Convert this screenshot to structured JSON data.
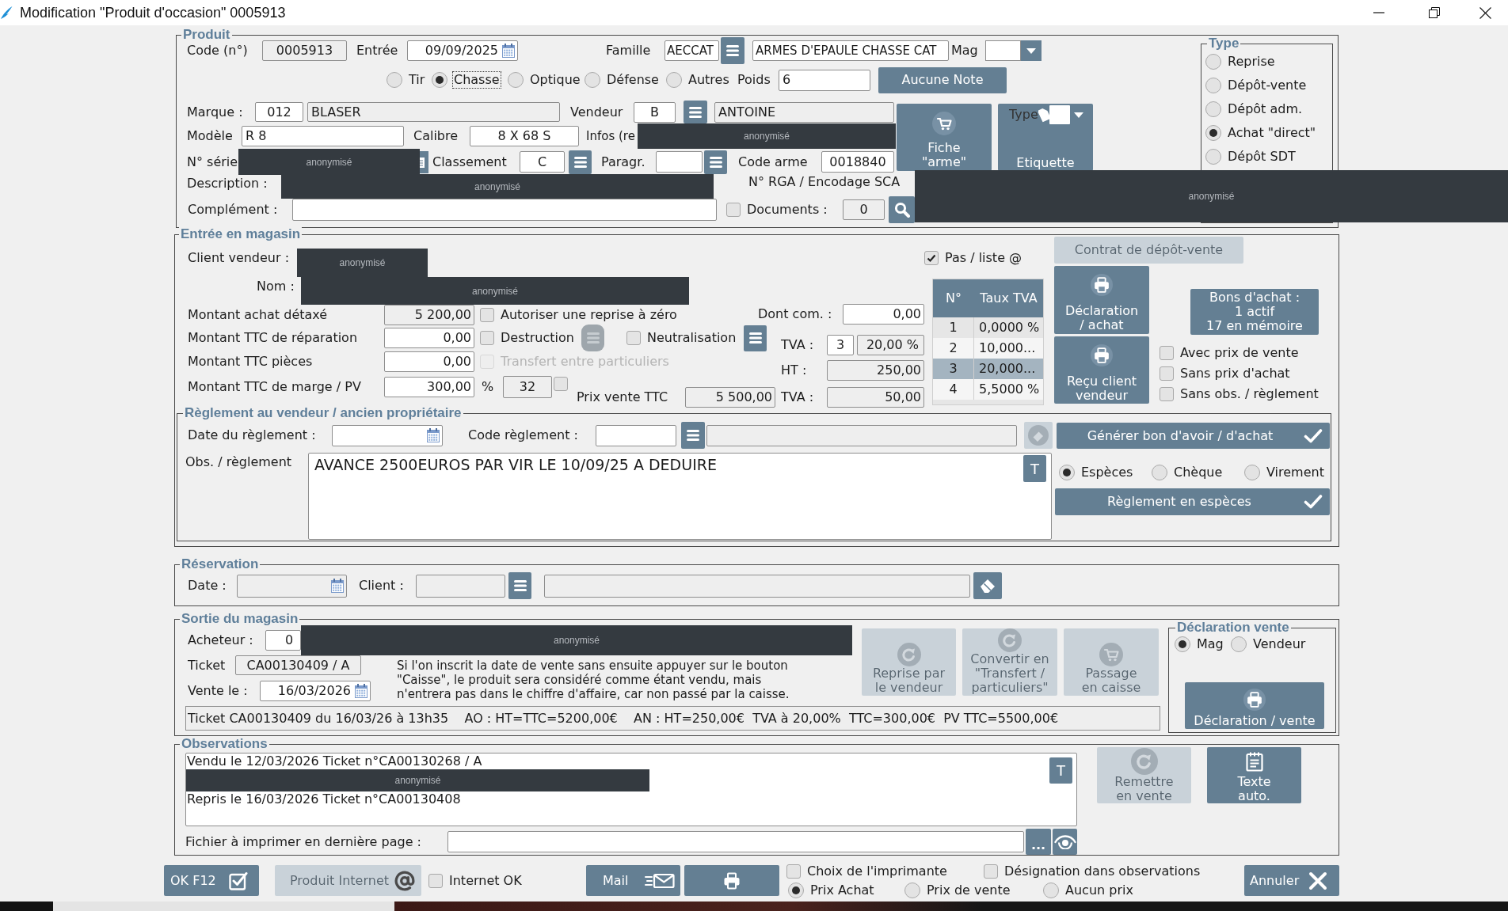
{
  "window": {
    "title": "Modification \"Produit d'occasion\" 0005913"
  },
  "produit": {
    "legend": "Produit",
    "code": {
      "label": "Code (n°)",
      "value": "0005913"
    },
    "entree": {
      "label": "Entrée",
      "value": "09/09/2025"
    },
    "famille": {
      "label": "Famille",
      "code": "AECCAT",
      "value": "ARMES D'EPAULE CHASSE CAT"
    },
    "mag": {
      "label": "Mag"
    },
    "categories": [
      {
        "label": "Tir",
        "selected": false,
        "focused": false
      },
      {
        "label": "Chasse",
        "selected": true,
        "focused": true
      },
      {
        "label": "Optique",
        "selected": false,
        "focused": false
      },
      {
        "label": "Défense",
        "selected": false,
        "focused": false
      },
      {
        "label": "Autres",
        "selected": false,
        "focused": false
      }
    ],
    "poids": {
      "label": "Poids",
      "value": "6"
    },
    "note_button": "Aucune Note",
    "marque": {
      "label": "Marque :",
      "code": "012",
      "value": "BLASER"
    },
    "vendeur": {
      "label": "Vendeur",
      "code": "B",
      "value": "ANTOINE"
    },
    "modele": {
      "label": "Modèle",
      "value": "R 8"
    },
    "calibre": {
      "label": "Calibre",
      "value": "8 X 68 S"
    },
    "infos": {
      "label": "Infos (re",
      "redaction": "anonymisé"
    },
    "serie": {
      "label": "N° série",
      "redaction": "anonymisé"
    },
    "classement": {
      "label": "Classement",
      "value": "C"
    },
    "paragraphe": {
      "label": "Paragr."
    },
    "code_arme": {
      "label": "Code arme",
      "value": "0018840"
    },
    "description": {
      "label": "Description :",
      "redaction": "anonymisé"
    },
    "rga": {
      "label": "N° RGA / Encodage SCA",
      "redaction": "anonymisé"
    },
    "complement": {
      "label": "Complément :"
    },
    "documents": {
      "label": "Documents :",
      "checked": false,
      "count": "0"
    },
    "fiche_button": "Fiche\n\"arme\"",
    "etiquette_button": {
      "label": "Etiquette",
      "type_label": "Type"
    },
    "type": {
      "legend": "Type",
      "options": [
        {
          "label": "Reprise",
          "selected": false
        },
        {
          "label": "Dépôt-vente",
          "selected": false
        },
        {
          "label": "Dépôt adm.",
          "selected": false
        },
        {
          "label": "Achat \"direct\"",
          "selected": true
        },
        {
          "label": "Dépôt SDT",
          "selected": false
        }
      ]
    }
  },
  "entree_magasin": {
    "legend": "Entrée en magasin",
    "client_vendeur": {
      "label": "Client vendeur :",
      "redaction": "anonymisé"
    },
    "nom": {
      "label": "Nom :",
      "redaction": "anonymisé"
    },
    "achat": {
      "label": "Montant achat détaxé",
      "value": "5 200,00"
    },
    "autoriser_zero": {
      "label": "Autoriser une reprise à zéro",
      "checked": false
    },
    "reparation": {
      "label": "Montant TTC de réparation",
      "value": "0,00"
    },
    "destruction": {
      "label": "Destruction",
      "checked": false
    },
    "destruction_list": {
      "disabled": true
    },
    "neutralisation": {
      "label": "Neutralisation",
      "checked": false
    },
    "pieces": {
      "label": "Montant TTC pièces",
      "value": "0,00"
    },
    "transfert": {
      "label": "Transfert entre particuliers",
      "checked": false,
      "disabled": true
    },
    "marge": {
      "label": "Montant TTC de marge / PV",
      "value": "300,00",
      "percent_label": "%",
      "percent": "32",
      "checked": false
    },
    "prix_vente": {
      "label": "Prix vente TTC",
      "value": "5 500,00"
    },
    "dont_com": {
      "label": "Dont com. :",
      "value": "0,00"
    },
    "tva": {
      "label": "TVA :",
      "code": "3",
      "rate": "20,00 %"
    },
    "ht": {
      "label": "HT :",
      "value": "250,00"
    },
    "tva_amount": {
      "label": "TVA :",
      "value": "50,00"
    },
    "pas_liste": {
      "label": "Pas / liste @",
      "checked": true
    },
    "tva_table": {
      "columns": [
        "N°",
        "Taux TVA"
      ],
      "rows": [
        {
          "cells": [
            "1",
            "0,0000 %"
          ],
          "selected": false
        },
        {
          "cells": [
            "2",
            "10,000..."
          ],
          "selected": false
        },
        {
          "cells": [
            "3",
            "20,000..."
          ],
          "selected": true
        },
        {
          "cells": [
            "4",
            "5,5000 %"
          ],
          "selected": false
        }
      ]
    },
    "contrat_button": {
      "label": "Contrat de dépôt-vente",
      "disabled": true
    },
    "declaration_achat_button": "Déclaration\n/ achat",
    "recu_button": "Reçu client\nvendeur",
    "bons_button": "Bons d'achat :\n1 actif\n17 en mémoire",
    "print_options": [
      {
        "label": "Avec prix de vente",
        "checked": false
      },
      {
        "label": "Sans prix d'achat",
        "checked": false
      },
      {
        "label": "Sans obs. / règlement",
        "checked": false
      }
    ]
  },
  "reglement": {
    "legend": "Règlement au vendeur / ancien propriétaire",
    "date": {
      "label": "Date du règlement :"
    },
    "code": {
      "label": "Code règlement :"
    },
    "eraser_button": {
      "disabled": true
    },
    "generer_button": "Générer bon d'avoir / d'achat",
    "obs": {
      "label": "Obs. / règlement",
      "value": "AVANCE 2500EUROS PAR VIR LE 10/09/25 A DEDUIRE",
      "t_button": "T"
    },
    "modes": [
      {
        "label": "Espèces",
        "selected": true
      },
      {
        "label": "Chèque",
        "selected": false
      },
      {
        "label": "Virement",
        "selected": false
      }
    ],
    "reglement_button": "Règlement en espèces"
  },
  "reservation": {
    "legend": "Réservation",
    "date": {
      "label": "Date :"
    },
    "client": {
      "label": "Client :"
    }
  },
  "sortie": {
    "legend": "Sortie du magasin",
    "acheteur": {
      "label": "Acheteur :",
      "value": "0",
      "redaction": "anonymisé"
    },
    "ticket": {
      "label": "Ticket",
      "value": "CA00130409 / A"
    },
    "vente": {
      "label": "Vente le :",
      "value": "16/03/2026"
    },
    "notice": "Si l'on inscrit la date de vente sans ensuite appuyer sur le bouton\n\"Caisse\", le produit sera considéré comme étant vendu, mais\nn'entrera pas dans le chiffre d'affaire, car non passé par la caisse.",
    "summary": "Ticket CA00130409 du 16/03/26 à 13h35    AO : HT=TTC=5200,00€    AN : HT=250,00€  TVA à 20,00%  TTC=300,00€  PV TTC=5500,00€",
    "actions": [
      {
        "kind": "rotate",
        "label": "Reprise par\nle vendeur",
        "disabled": true
      },
      {
        "kind": "rotate",
        "label": "Convertir en\n\"Transfert /\nparticuliers\"",
        "disabled": true
      },
      {
        "kind": "cart",
        "label": "Passage\nen caisse",
        "disabled": true
      }
    ],
    "declaration": {
      "legend": "Déclaration vente",
      "options": [
        {
          "label": "Mag",
          "selected": true
        },
        {
          "label": "Vendeur",
          "selected": false
        }
      ],
      "button": "Déclaration / vente"
    }
  },
  "observations": {
    "legend": "Observations",
    "lines": [
      "Vendu le 12/03/2026 Ticket n°CA00130268 / A",
      "Repris le 16/03/2026 Ticket n°CA00130408"
    ],
    "redaction": "anonymisé",
    "t_button": "T",
    "remettre_button": {
      "label": "Remettre\nen vente",
      "disabled": true
    },
    "texte_button": "Texte\nauto.",
    "fichier": {
      "label": "Fichier à imprimer en dernière page :",
      "browse": "..."
    }
  },
  "footer": {
    "ok_button": "OK F12",
    "internet_button": {
      "label": "Produit Internet",
      "disabled": true
    },
    "internet_ok": {
      "label": "Internet OK",
      "checked": false
    },
    "mail_button": "Mail",
    "choix_imprimante": {
      "label": "Choix de l'imprimante",
      "checked": false
    },
    "designation": {
      "label": "Désignation dans observations",
      "checked": false
    },
    "prices": [
      {
        "label": "Prix Achat",
        "selected": true
      },
      {
        "label": "Prix de vente",
        "selected": false
      },
      {
        "label": "Aucun prix",
        "selected": false
      }
    ],
    "cancel_button": "Annuler"
  }
}
